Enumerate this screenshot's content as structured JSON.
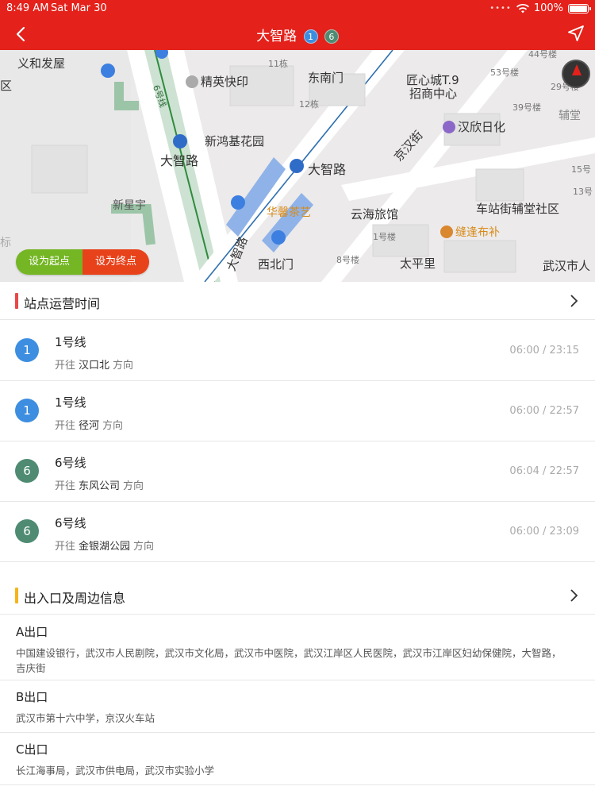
{
  "status_bar": {
    "time": "8:49 AM",
    "date": "Sat Mar 30",
    "battery": "100%"
  },
  "header": {
    "title": "大智路",
    "lines": [
      {
        "num": "1",
        "color": "#3d8ee0"
      },
      {
        "num": "6",
        "color": "#4e8b72"
      }
    ]
  },
  "map": {
    "labels": {
      "yihefazhan": "义和发屋",
      "qu": "区",
      "jingyingkuaiyin": "精英快印",
      "dongnanmen": "东南门",
      "jiangxincheng": "匠心城T.9",
      "zhaoshang": "招商中心",
      "hanxinrihua": "汉欣日化",
      "floor11": "11栋",
      "floor12": "12栋",
      "floor53": "53号楼",
      "floor39": "39号楼",
      "floor29": "29号楼",
      "floor44": "44号楼",
      "floor15": "15号",
      "floor13": "13号",
      "fudang": "辅堂",
      "xinhongji": "新鸿基花园",
      "dazhilu_left": "大智路",
      "dazhilu_center": "大智路",
      "jinghanjie": "京汉街",
      "xinxingyu": "新星宇",
      "huaxinchayi": "华馨茶艺",
      "yunhailvguan": "云海旅馆",
      "chezhanjie": "车站街辅堂社区",
      "floor1": "1号楼",
      "jianfengbubu": "缝逢布补",
      "xibeimen": "西北门",
      "floor8": "8号楼",
      "taipingli": "太平里",
      "wuhanshiren": "武汉市人",
      "dazhi_road_vertical": "大智路",
      "line6": "6号线",
      "biao": "标"
    }
  },
  "map_buttons": {
    "set_start": "设为起点",
    "set_end": "设为终点"
  },
  "operation": {
    "title": "站点运营时间",
    "accent": "#e84848",
    "rows": [
      {
        "line": "1",
        "name": "1号线",
        "prefix": "开往",
        "dest": "汉口北",
        "suffix": "方向",
        "time": "06:00 / 23:15",
        "color": "#3d8ee0"
      },
      {
        "line": "1",
        "name": "1号线",
        "prefix": "开往",
        "dest": "径河",
        "suffix": "方向",
        "time": "06:00 / 22:57",
        "color": "#3d8ee0"
      },
      {
        "line": "6",
        "name": "6号线",
        "prefix": "开往",
        "dest": "东风公司",
        "suffix": "方向",
        "time": "06:04 / 22:57",
        "color": "#4e8b72"
      },
      {
        "line": "6",
        "name": "6号线",
        "prefix": "开往",
        "dest": "金银湖公园",
        "suffix": "方向",
        "time": "06:00 / 23:09",
        "color": "#4e8b72"
      }
    ]
  },
  "exits": {
    "title": "出入口及周边信息",
    "accent": "#f5b51a",
    "items": [
      {
        "name": "A出口",
        "desc": "中国建设银行，武汉市人民剧院，武汉市文化局，武汉市中医院，武汉江岸区人民医院，武汉市江岸区妇幼保健院，大智路，吉庆街"
      },
      {
        "name": "B出口",
        "desc": "武汉市第十六中学，京汉火车站"
      },
      {
        "name": "C出口",
        "desc": "长江海事局，武汉市供电局，武汉市实验小学"
      }
    ]
  }
}
